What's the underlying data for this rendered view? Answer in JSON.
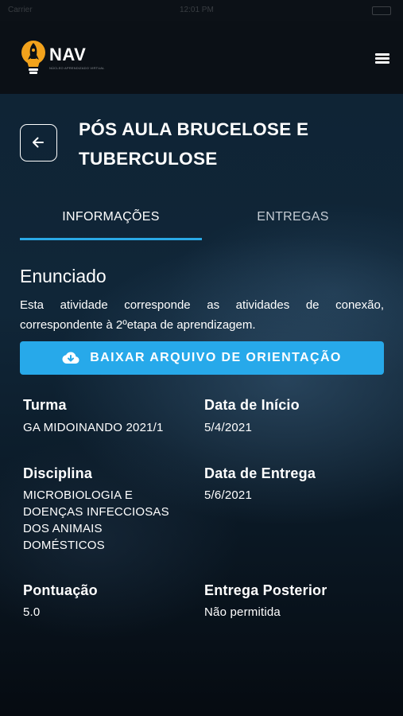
{
  "status_bar": {
    "carrier": "Carrier",
    "time": "12:01 PM"
  },
  "header": {
    "logo_text": "NAV",
    "logo_subtitle": "NÚCLEO APRENDIZADO VIRTUAL",
    "menu_icon": "hamburger-menu-icon"
  },
  "page": {
    "title": "PÓS AULA BRUCELOSE E TUBERCULOSE",
    "back_icon": "arrow-left-icon"
  },
  "tabs": [
    {
      "label": "INFORMAÇÕES",
      "active": true
    },
    {
      "label": "ENTREGAS",
      "active": false
    }
  ],
  "statement": {
    "heading": "Enunciado",
    "text": "Esta atividade corresponde as atividades de conexão, correspondente à 2ºetapa de aprendizagem."
  },
  "download_button": {
    "label": "BAIXAR ARQUIVO DE ORIENTAÇÃO",
    "icon": "cloud-download-icon"
  },
  "details": {
    "turma": {
      "label": "Turma",
      "value": "GA MIDOINANDO 2021/1"
    },
    "data_inicio": {
      "label": "Data de Início",
      "value": "5/4/2021"
    },
    "disciplina": {
      "label": "Disciplina",
      "value": "MICROBIOLOGIA E DOENÇAS INFECCIOSAS DOS ANIMAIS DOMÉSTICOS"
    },
    "data_entrega": {
      "label": "Data de Entrega",
      "value": "5/6/2021"
    },
    "pontuacao": {
      "label": "Pontuação",
      "value": "5.0"
    },
    "entrega_posterior": {
      "label": "Entrega Posterior",
      "value": "Não permitida"
    }
  },
  "colors": {
    "accent": "#27a9ea",
    "header_bg": "#0b1016",
    "text": "#ffffff"
  }
}
